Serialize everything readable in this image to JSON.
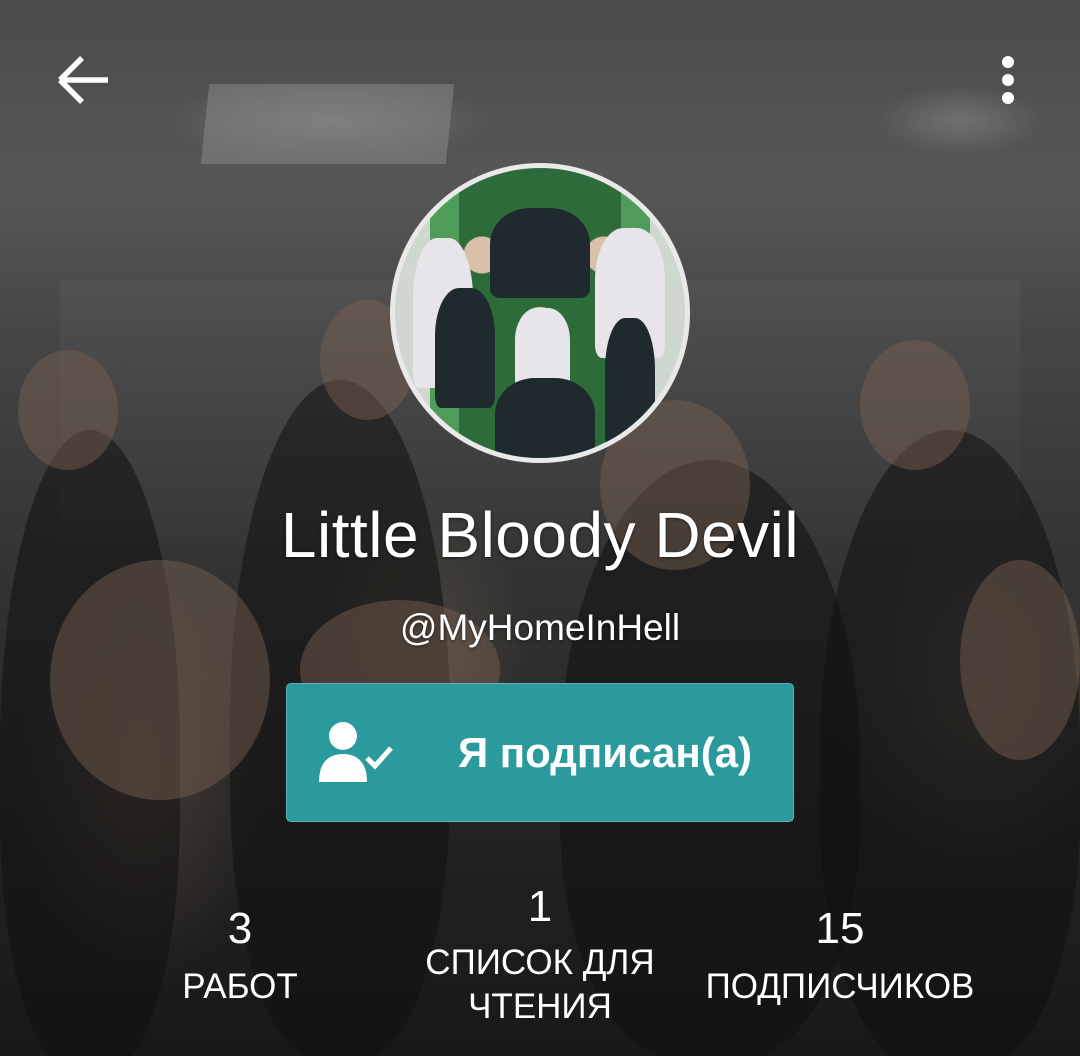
{
  "header": {
    "back_icon": "arrow-back-icon",
    "menu_icon": "more-vertical-icon"
  },
  "profile": {
    "display_name": "Little Bloody Devil",
    "username": "@MyHomeInHell"
  },
  "follow_button": {
    "label": "Я подписан(а)",
    "icon": "user-check-icon",
    "color": "#2b9a9c"
  },
  "stats": {
    "works": {
      "value": "3",
      "label": "РАБОТ"
    },
    "reading_lists": {
      "value": "1",
      "label_line1": "СПИСОК ДЛЯ",
      "label_line2": "ЧТЕНИЯ"
    },
    "followers": {
      "value": "15",
      "label": "ПОДПИСЧИКОВ"
    }
  }
}
